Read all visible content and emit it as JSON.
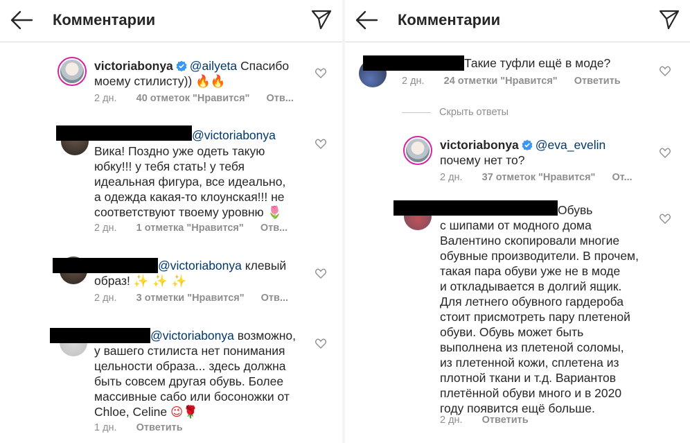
{
  "header": {
    "title": "Комментарии"
  },
  "left": {
    "comments": [
      {
        "user": "victoriabonya",
        "mention": "@ailyeta",
        "lines": [
          "Спасибо",
          "моему стилисту))"
        ],
        "emoji": "🔥🔥",
        "time": "2 дн.",
        "likes": "40 отметок \"Нравится\"",
        "reply": "Отв..."
      },
      {
        "mention": "@victoriabonya",
        "lines": [
          "Вика! Поздно уже одеть такую",
          "юбку!!! у тебя стать! у тебя",
          "идеальная фигура, все идеально,",
          "а одежда какая-то клоунская!!! не",
          "соответствуют твоему уровню"
        ],
        "emoji": "🌷",
        "time": "2 дн.",
        "likes": "1 отметка \"Нравится\"",
        "reply": "Отв..."
      },
      {
        "mention": "@victoriabonya",
        "lines": [
          "клевый",
          "образ!"
        ],
        "emoji": "✨ ✨ ✨",
        "time": "2 дн.",
        "likes": "3 отметки \"Нравится\"",
        "reply": "Отв..."
      },
      {
        "mention": "@victoriabonya",
        "lines": [
          "возможно,",
          "у вашего стилиста нет понимания",
          "цельности образа... здесь должна",
          "быть совсем другая обувь. Более",
          "массивные сабо или босоножки от",
          "Chloe, Celine"
        ],
        "emoji": "😉🌹",
        "time": "1 дн.",
        "reply": "Ответить"
      }
    ]
  },
  "right": {
    "comments": [
      {
        "lines": [
          "Такие туфли ещё в моде?"
        ],
        "time": "2 дн.",
        "likes": "24 отметки \"Нравится\"",
        "reply": "Ответить"
      },
      {
        "user": "victoriabonya",
        "mention": "@eva_evelin",
        "lines": [
          "почему нет то?"
        ],
        "time": "2 дн.",
        "likes": "37 отметок \"Нравится\"",
        "reply": "От..."
      },
      {
        "lines": [
          "Обувь",
          "с шипами от модного дома",
          "Валентино скопировали многие",
          "обувные производители. В прочем,",
          "такая пара обуви уже не в моде",
          "и откладывается в долгий ящик.",
          "Для летнего обувного гардероба",
          "стоит присмотреть пару плетеной",
          "обуви. Обувь может быть",
          "выполнена из плетеной соломы,",
          "из плетенной кожи, сплетена из",
          "плотной ткани и т.д. Вариантов",
          "плетённой обуви много и в 2020",
          "году появится ещё больше."
        ],
        "time": "2 дн.",
        "reply": "Ответить"
      }
    ],
    "hide_replies": "Скрыть ответы"
  },
  "icons": {
    "back": "arrow-left-icon",
    "send": "paper-plane-icon",
    "heart": "heart-outline-icon",
    "verified": "verified-badge-icon"
  },
  "colors": {
    "mention": "#00376b",
    "verified": "#3897f0",
    "meta": "#8e8e8e"
  }
}
